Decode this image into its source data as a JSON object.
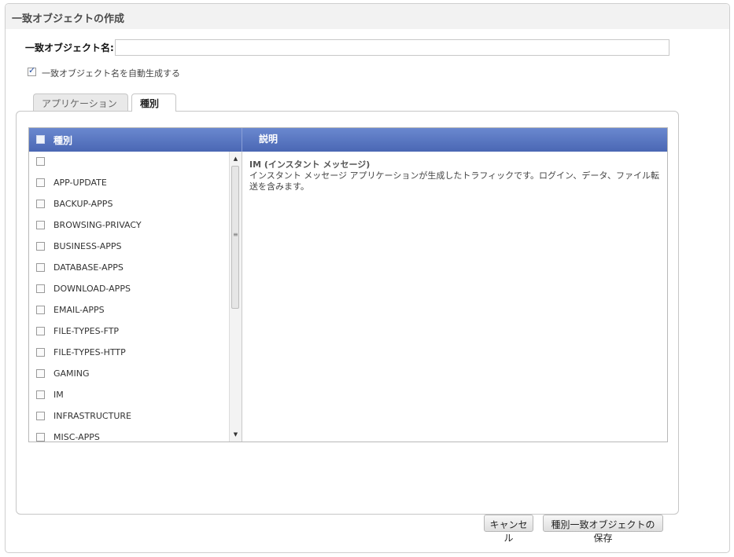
{
  "dialog": {
    "title": "一致オブジェクトの作成"
  },
  "form": {
    "name_label": "一致オブジェクト名:",
    "name_value": "",
    "auto_generate_label": "一致オブジェクト名を自動生成する",
    "auto_generate_checked": true
  },
  "tabs": [
    {
      "label": "アプリケーション",
      "active": false
    },
    {
      "label": "種別",
      "active": true
    }
  ],
  "table": {
    "col_kind": "種別",
    "col_description": "説明",
    "rows": [
      "",
      "APP-UPDATE",
      "BACKUP-APPS",
      "BROWSING-PRIVACY",
      "BUSINESS-APPS",
      "DATABASE-APPS",
      "DOWNLOAD-APPS",
      "EMAIL-APPS",
      "FILE-TYPES-FTP",
      "FILE-TYPES-HTTP",
      "GAMING",
      "IM",
      "INFRASTRUCTURE",
      "MISC-APPS"
    ]
  },
  "description": {
    "title": "IM (インスタント メッセージ)",
    "text": "インスタント メッセージ アプリケーションが生成したトラフィックです。ログイン、データ、ファイル転送を含みます。"
  },
  "buttons": {
    "cancel": "キャンセル",
    "save": "種別一致オブジェクトの保存"
  },
  "scrollbar_grip": "≡",
  "scroll_up": "▲",
  "scroll_down": "▼"
}
